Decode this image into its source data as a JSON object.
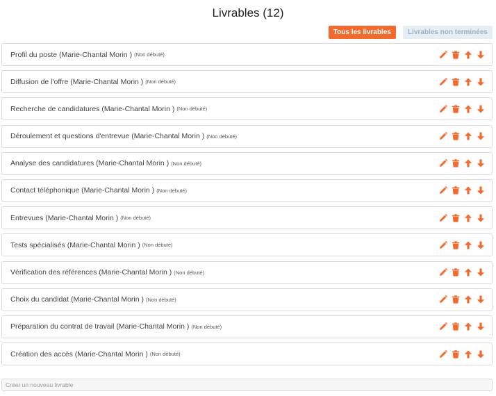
{
  "header": {
    "title": "Livrables (12)"
  },
  "filters": {
    "all_label": "Tous les livrables",
    "unfinished_label": "Livrables non terminées"
  },
  "colors": {
    "accent": "#f26a2e",
    "inactive_bg": "#e6eef5",
    "inactive_text": "#9fb0bf"
  },
  "icons": [
    "pencil-icon",
    "trash-icon",
    "arrow-up-icon",
    "arrow-down-icon"
  ],
  "deliverables": [
    {
      "label": "Profil du poste (Marie-Chantal Morin )",
      "status": "(Non débuté)"
    },
    {
      "label": "Diffusion de l'offre (Marie-Chantal Morin )",
      "status": "(Non débuté)"
    },
    {
      "label": "Recherche de candidatures (Marie-Chantal Morin )",
      "status": "(Non débuté)"
    },
    {
      "label": "Déroulement et questions d'entrevue (Marie-Chantal Morin )",
      "status": "(Non débuté)"
    },
    {
      "label": "Analyse des candidatures (Marie-Chantal Morin )",
      "status": "(Non débuté)"
    },
    {
      "label": "Contact téléphonique (Marie-Chantal Morin )",
      "status": "(Non débuté)"
    },
    {
      "label": "Entrevues (Marie-Chantal Morin )",
      "status": "(Non débuté)"
    },
    {
      "label": "Tests spécialisés (Marie-Chantal Morin )",
      "status": "(Non débuté)"
    },
    {
      "label": "Vérification des références (Marie-Chantal Morin )",
      "status": "(Non débuté)"
    },
    {
      "label": "Choix du candidat (Marie-Chantal Morin )",
      "status": "(Non débuté)"
    },
    {
      "label": "Préparation du contrat de travail (Marie-Chantal Morin )",
      "status": "(Non débuté)"
    },
    {
      "label": "Création des accès (Marie-Chantal Morin )",
      "status": "(Non débuté)"
    }
  ],
  "new_deliverable": {
    "placeholder": "Créer un nouveau livrable",
    "value": ""
  }
}
